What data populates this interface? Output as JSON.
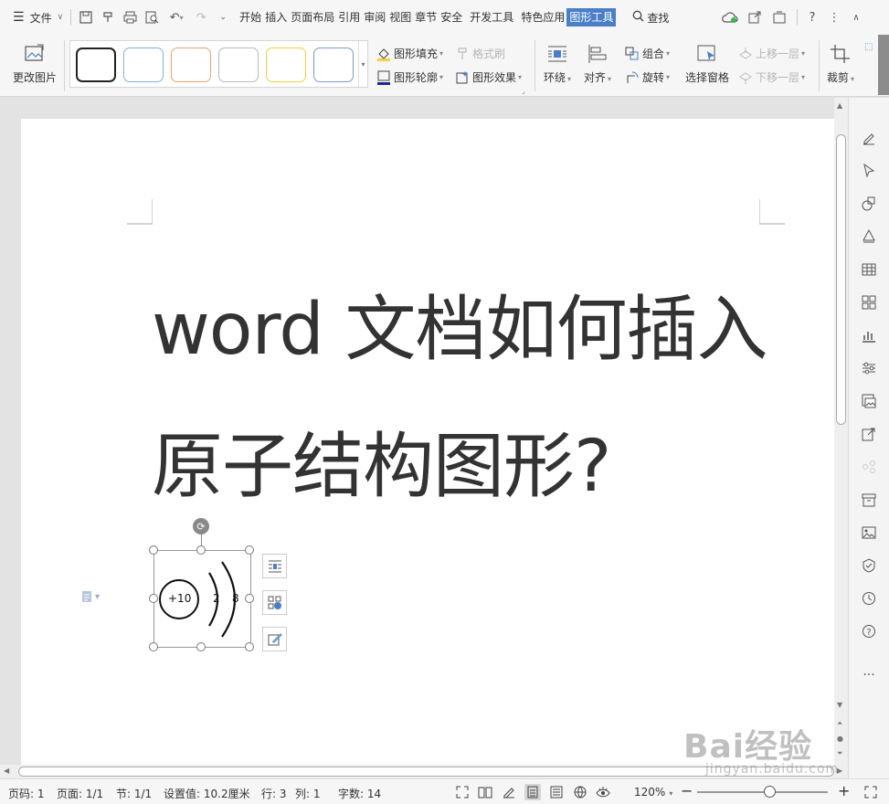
{
  "menubar": {
    "menu_label": "文件",
    "tabs": [
      "开始",
      "插入",
      "页面布局",
      "引用",
      "审阅",
      "视图",
      "章节",
      "安全",
      "开发工具",
      "特色应用",
      "图形工具"
    ],
    "active_tab": "图形工具",
    "search_label": "查找"
  },
  "ribbon": {
    "change_picture": "更改图片",
    "shape_fill": "图形填充",
    "format_painter": "格式刷",
    "shape_outline": "图形轮廓",
    "shape_effect": "图形效果",
    "wrap": "环绕",
    "align": "对齐",
    "group": "组合",
    "rotate": "旋转",
    "selection_pane": "选择窗格",
    "bring_forward": "上移一层",
    "send_backward": "下移一层",
    "crop": "裁剪",
    "style_swatches": [
      {
        "border": "#222222"
      },
      {
        "border": "#7fb2e0"
      },
      {
        "border": "#eaa46a"
      },
      {
        "border": "#b9b9b9"
      },
      {
        "border": "#f2cf3e"
      },
      {
        "border": "#7c9bd1"
      }
    ]
  },
  "document": {
    "title_line1": "word 文档如何插入",
    "title_line2": "原子结构图形?",
    "atom": {
      "nucleus_label": "+10",
      "shell1_electrons": "2",
      "shell2_electrons": "8"
    }
  },
  "statusbar": {
    "page_no": "页码: 1",
    "pages": "页面: 1/1",
    "section": "节: 1/1",
    "setting": "设置值: 10.2厘米",
    "row": "行: 3",
    "col": "列: 1",
    "word_count": "字数: 14",
    "zoom": "120%"
  },
  "watermark": {
    "brand": "Bai经验",
    "url": "jingyan.baidu.com"
  }
}
